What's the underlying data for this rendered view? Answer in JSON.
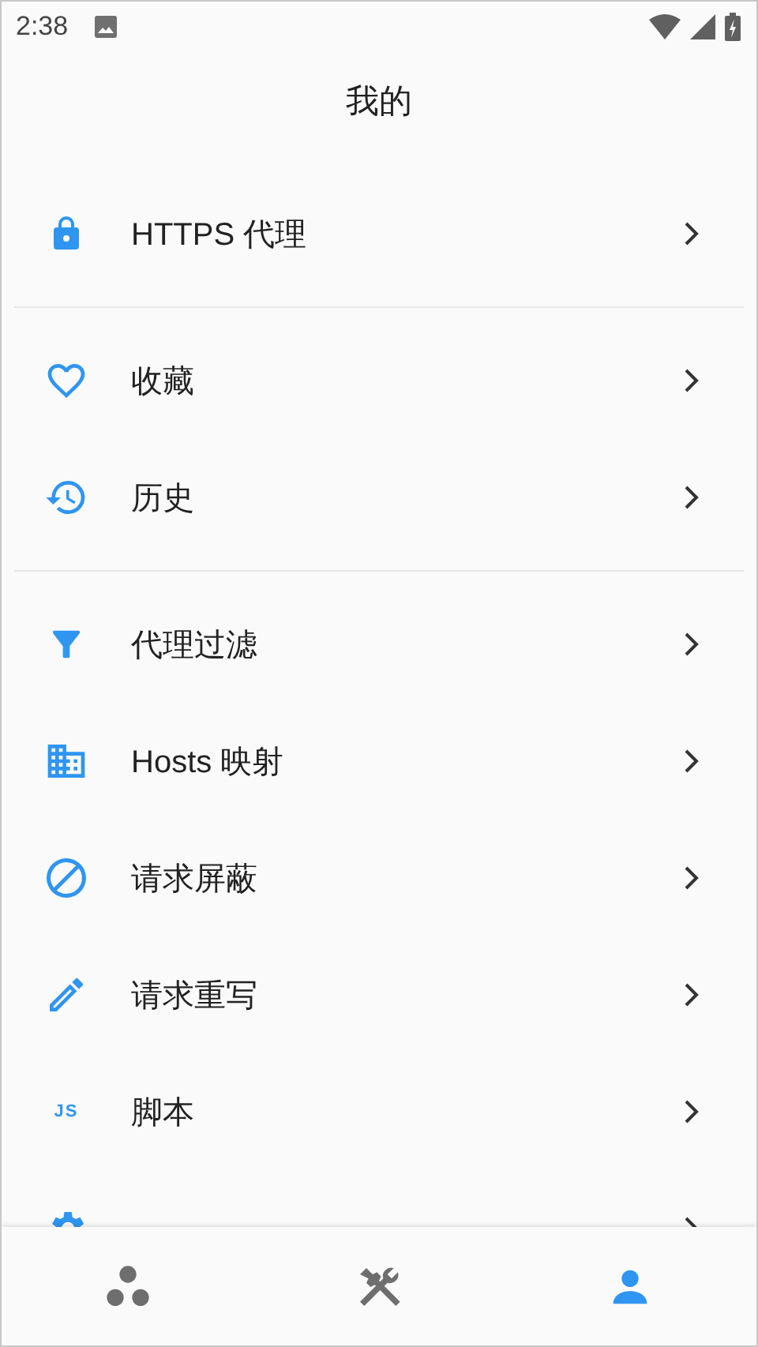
{
  "status_bar": {
    "time": "2:38"
  },
  "title": "我的",
  "sections": [
    [
      {
        "kind": "lock",
        "label": "HTTPS 代理"
      }
    ],
    [
      {
        "kind": "heart",
        "label": "收藏"
      },
      {
        "kind": "history",
        "label": "历史"
      }
    ],
    [
      {
        "kind": "filter",
        "label": "代理过滤"
      },
      {
        "kind": "building",
        "label": "Hosts 映射"
      },
      {
        "kind": "block",
        "label": "请求屏蔽"
      },
      {
        "kind": "pencil",
        "label": "请求重写"
      },
      {
        "kind": "text",
        "icon_text": "JS",
        "label": "脚本"
      },
      {
        "kind": "gear"
      }
    ]
  ],
  "bottom_nav": [
    {
      "selected": false
    },
    {
      "selected": false
    },
    {
      "selected": true
    }
  ]
}
